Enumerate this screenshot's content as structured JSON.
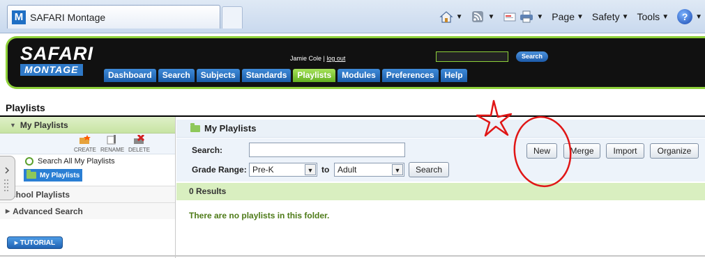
{
  "browser": {
    "tab_title": "SAFARI Montage",
    "tab_logo_letter": "M",
    "commands": {
      "page": "Page",
      "safety": "Safety",
      "tools": "Tools",
      "help": "?"
    }
  },
  "header": {
    "logo_top": "SAFARI",
    "logo_bottom": "MONTAGE",
    "user_name": "Jamie Cole",
    "separator": "|",
    "logout": "log out",
    "search_button": "Search",
    "nav": [
      "Dashboard",
      "Search",
      "Subjects",
      "Standards",
      "Playlists",
      "Modules",
      "Preferences",
      "Help"
    ],
    "active_nav": "Playlists"
  },
  "page": {
    "title": "Playlists"
  },
  "sidebar": {
    "header": "My Playlists",
    "tools": {
      "create": "CREATE",
      "rename": "RENAME",
      "delete": "DELETE"
    },
    "search_all": "Search All My Playlists",
    "active_folder": "My Playlists",
    "school": "School Playlists",
    "advanced": "Advanced Search",
    "tutorial": "TUTORIAL"
  },
  "main": {
    "title": "My Playlists",
    "search_label": "Search:",
    "search_value": "",
    "grade_label": "Grade Range:",
    "grade_from": "Pre-K",
    "to_label": "to",
    "grade_to": "Adult",
    "search_button": "Search",
    "buttons": {
      "new": "New",
      "merge": "Merge",
      "import": "Import",
      "organize": "Organize"
    },
    "results": "0 Results",
    "empty_message": "There are no playlists in this folder."
  },
  "colors": {
    "nav_blue": "#1b5eaa",
    "nav_active_green": "#63b020",
    "results_green": "#d9efc0",
    "annotation_red": "#e01616"
  }
}
